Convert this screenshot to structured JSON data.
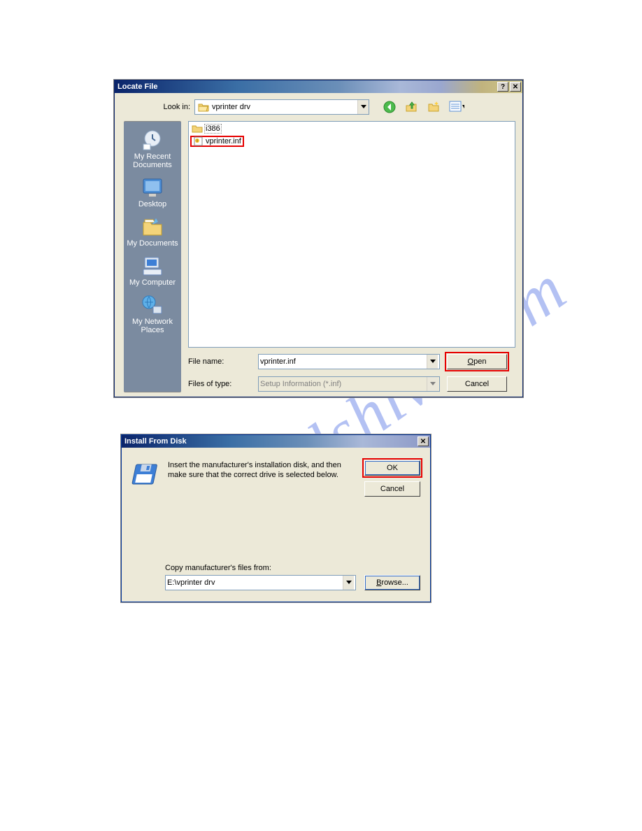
{
  "watermark": "manualshive.com",
  "dialog1": {
    "title": "Locate File",
    "look_in_label": "Look in:",
    "look_in_value": "vprinter drv",
    "sidebar": [
      {
        "label": "My Recent Documents"
      },
      {
        "label": "Desktop"
      },
      {
        "label": "My Documents"
      },
      {
        "label": "My Computer"
      },
      {
        "label": "My Network Places"
      }
    ],
    "files": [
      {
        "name": "i386",
        "type": "folder"
      },
      {
        "name": "vprinter.inf",
        "type": "inf",
        "highlight": true
      }
    ],
    "filename_label": "File name:",
    "filename_value": "vprinter.inf",
    "filetype_label": "Files of type:",
    "filetype_value": "Setup Information (*.inf)",
    "open_label": "Open",
    "cancel_label": "Cancel"
  },
  "dialog2": {
    "title": "Install From Disk",
    "message": "Insert the manufacturer's installation disk, and then make sure that the correct drive is selected below.",
    "ok_label": "OK",
    "cancel_label": "Cancel",
    "copy_from_label": "Copy manufacturer's files from:",
    "copy_from_value": "E:\\vprinter drv",
    "browse_label": "Browse..."
  }
}
